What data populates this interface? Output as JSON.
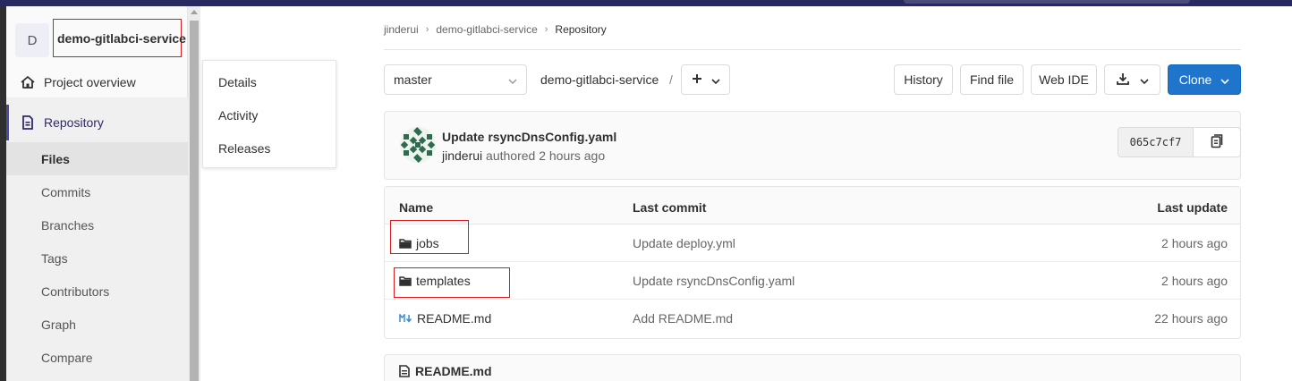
{
  "project": {
    "avatar_letter": "D",
    "name": "demo-gitlabci-service"
  },
  "sidebar": {
    "project_overview": "Project overview",
    "repository": "Repository",
    "items": [
      "Files",
      "Commits",
      "Branches",
      "Tags",
      "Contributors",
      "Graph",
      "Compare"
    ]
  },
  "flyout": {
    "items": [
      "Details",
      "Activity",
      "Releases"
    ]
  },
  "breadcrumb": {
    "items": [
      "jinderui",
      "demo-gitlabci-service",
      "Repository"
    ]
  },
  "toolbar": {
    "branch": "master",
    "path": "demo-gitlabci-service",
    "path_sep": "/",
    "history": "History",
    "find_file": "Find file",
    "web_ide": "Web IDE",
    "clone": "Clone"
  },
  "last_commit": {
    "title": "Update rsyncDnsConfig.yaml",
    "author": "jinderui",
    "meta_suffix": "authored 2 hours ago",
    "sha": "065c7cf7"
  },
  "file_tree": {
    "headers": {
      "name": "Name",
      "last_commit": "Last commit",
      "last_update": "Last update"
    },
    "rows": [
      {
        "name": "jobs",
        "type": "folder",
        "last_commit": "Update deploy.yml",
        "last_update": "2 hours ago"
      },
      {
        "name": "templates",
        "type": "folder",
        "last_commit": "Update rsyncDnsConfig.yaml",
        "last_update": "2 hours ago"
      },
      {
        "name": "README.md",
        "type": "markdown",
        "last_commit": "Add README.md",
        "last_update": "22 hours ago"
      }
    ]
  },
  "readme": {
    "title": "README.md"
  },
  "colors": {
    "brand_dark": "#292961",
    "clone_blue": "#1f75cb",
    "highlight_red": "#d81b1b"
  }
}
